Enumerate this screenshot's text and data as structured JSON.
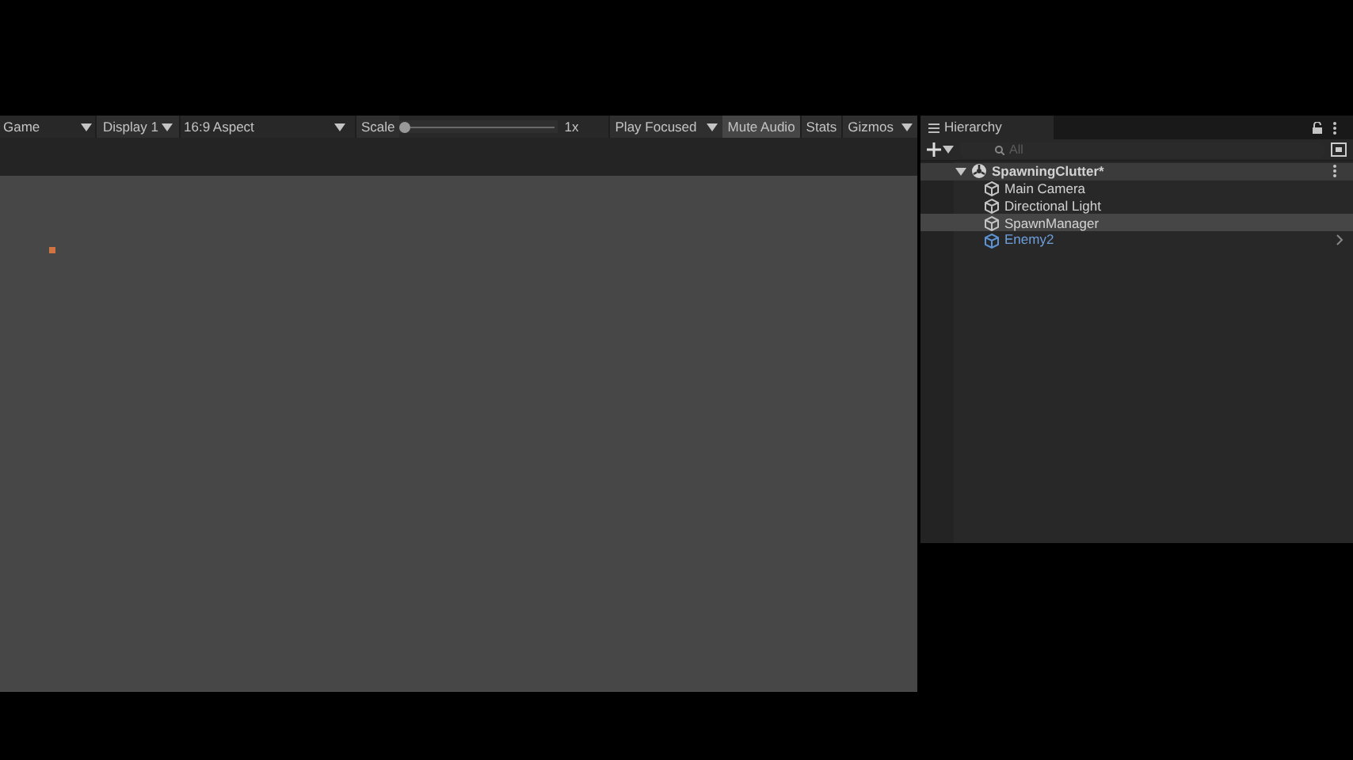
{
  "game_view": {
    "tab": "Game",
    "display": "Display 1",
    "aspect": "16:9 Aspect",
    "scale_label": "Scale",
    "scale": {
      "level": 0.0
    },
    "scale_value": "1x",
    "play_mode": "Play Focused",
    "mute_audio": {
      "label": "Mute Audio",
      "on": true
    },
    "stats": "Stats",
    "gizmos": "Gizmos"
  },
  "hierarchy": {
    "title": "Hierarchy",
    "search": {
      "placeholder": "All"
    },
    "items": [
      {
        "label": "SpawningClutter*",
        "kind": "scene",
        "expanded": true,
        "children": [
          {
            "label": "Main Camera",
            "kind": "object",
            "selected": false
          },
          {
            "label": "Directional Light",
            "kind": "object",
            "selected": false
          },
          {
            "label": "SpawnManager",
            "kind": "object",
            "selected": true
          },
          {
            "label": "Enemy2",
            "kind": "prefab",
            "selected": false
          }
        ]
      }
    ]
  }
}
